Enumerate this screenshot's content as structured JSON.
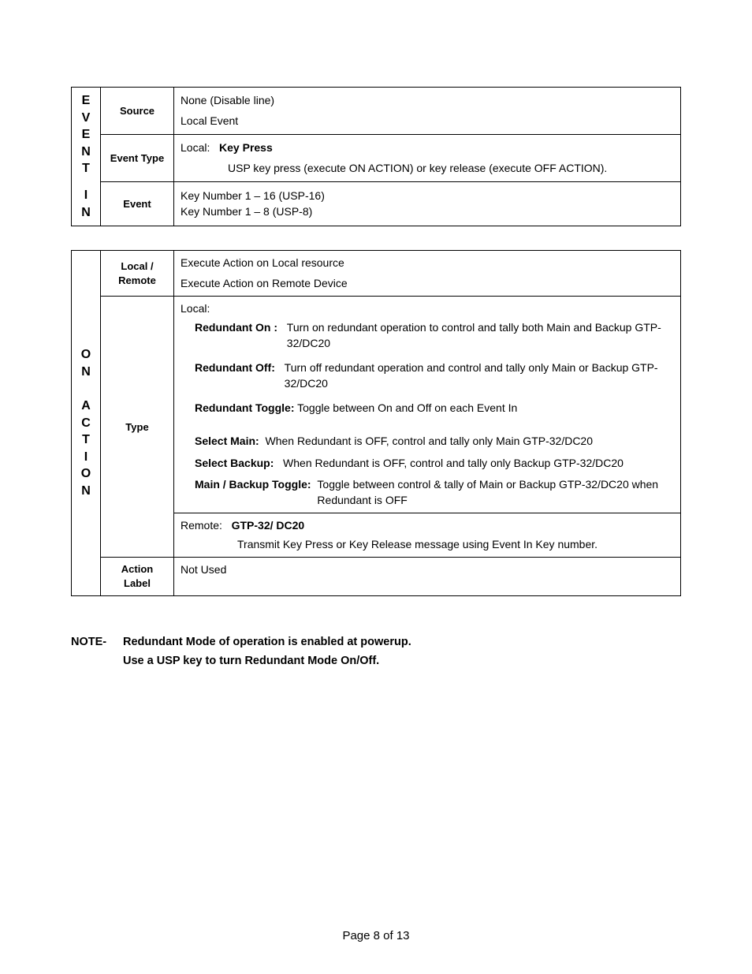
{
  "table1": {
    "sideA": "E\nV\nE\nN\nT",
    "sideB": "I\nN",
    "rows": [
      {
        "label": "Source",
        "lines": [
          "None  (Disable line)",
          "Local Event"
        ]
      },
      {
        "label": "Event Type",
        "local_prefix": "Local:",
        "local_bold": "Key Press",
        "desc": "USP key press (execute ON ACTION) or key release (execute OFF ACTION)."
      },
      {
        "label": "Event",
        "lines": [
          "Key Number 1 – 16 (USP-16)",
          "Key Number 1 – 8 (USP-8)"
        ]
      }
    ]
  },
  "table2": {
    "side": "O\nN\n\nA\nC\nT\nI\nO\nN",
    "rows": {
      "lr": {
        "label": "Local / Remote",
        "lines": [
          "Execute Action on Local resource",
          "Execute Action on Remote Device"
        ]
      },
      "type": {
        "label": "Type",
        "local_label": "Local:",
        "items": [
          {
            "bold": "Redundant On :",
            "text": "Turn on redundant operation to control and tally both Main and Backup GTP-32/DC20"
          },
          {
            "bold": "Redundant Off:",
            "text": "Turn off redundant operation and control and tally only Main or Backup GTP-32/DC20"
          },
          {
            "bold": "Redundant Toggle:",
            "text": "Toggle between On and Off on each Event In"
          },
          {
            "bold": "Select Main:",
            "text": "When Redundant is OFF, control and tally only Main GTP-32/DC20"
          },
          {
            "bold": "Select Backup:",
            "text": "When Redundant is OFF, control and tally only Backup GTP-32/DC20"
          },
          {
            "bold": "Main / Backup Toggle:",
            "text": "Toggle between control & tally of Main or Backup  GTP-32/DC20 when Redundant is OFF"
          }
        ],
        "remote_prefix": "Remote:",
        "remote_bold": "GTP-32/ DC20",
        "remote_desc": "Transmit Key Press or Key Release message using Event In Key number."
      },
      "al": {
        "label": "Action Label",
        "text": "Not Used"
      }
    }
  },
  "note": {
    "label": "NOTE-",
    "line1": "Redundant Mode of operation is enabled at powerup.",
    "line2": "Use a USP key to turn Redundant Mode On/Off."
  },
  "footer": "Page 8 of 13"
}
